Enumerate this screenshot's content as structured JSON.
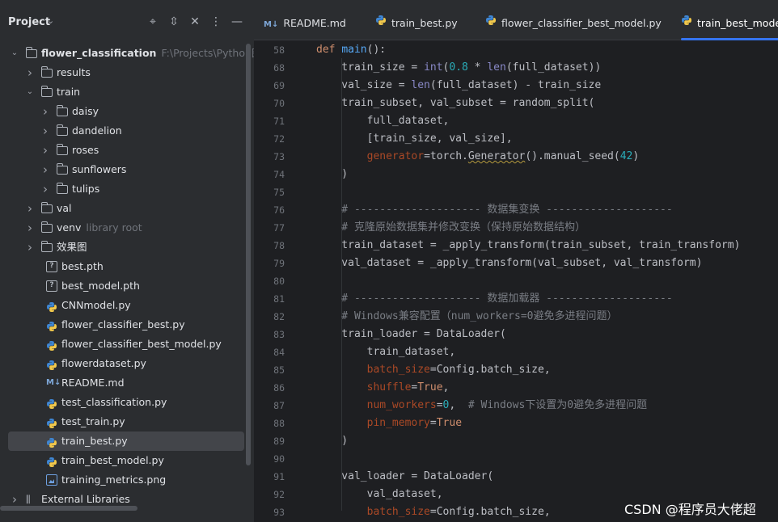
{
  "project_panel": {
    "title": "Project",
    "header_icons": [
      "locate-icon",
      "expand-collapse-icon",
      "collapse-all-icon",
      "more-options-icon",
      "minimize-icon"
    ],
    "tree": [
      {
        "depth": 0,
        "type": "folder",
        "expanded": true,
        "name": "flower_classification",
        "hint": "F:\\Projects\\Python图像识",
        "bold": true
      },
      {
        "depth": 1,
        "type": "folder",
        "expanded": false,
        "name": "results"
      },
      {
        "depth": 1,
        "type": "folder",
        "expanded": true,
        "name": "train"
      },
      {
        "depth": 2,
        "type": "folder",
        "expanded": false,
        "name": "daisy"
      },
      {
        "depth": 2,
        "type": "folder",
        "expanded": false,
        "name": "dandelion"
      },
      {
        "depth": 2,
        "type": "folder",
        "expanded": false,
        "name": "roses"
      },
      {
        "depth": 2,
        "type": "folder",
        "expanded": false,
        "name": "sunflowers"
      },
      {
        "depth": 2,
        "type": "folder",
        "expanded": false,
        "name": "tulips"
      },
      {
        "depth": 1,
        "type": "folder",
        "expanded": false,
        "name": "val"
      },
      {
        "depth": 1,
        "type": "folder",
        "expanded": false,
        "name": "venv",
        "hint": "library root"
      },
      {
        "depth": 1,
        "type": "folder",
        "expanded": false,
        "name": "效果图"
      },
      {
        "depth": 1,
        "type": "unknown",
        "name": "best.pth"
      },
      {
        "depth": 1,
        "type": "unknown",
        "name": "best_model.pth"
      },
      {
        "depth": 1,
        "type": "python",
        "name": "CNNmodel.py"
      },
      {
        "depth": 1,
        "type": "python",
        "name": "flower_classifier_best.py"
      },
      {
        "depth": 1,
        "type": "python",
        "name": "flower_classifier_best_model.py"
      },
      {
        "depth": 1,
        "type": "python",
        "name": "flowerdataset.py"
      },
      {
        "depth": 1,
        "type": "markdown",
        "name": "README.md"
      },
      {
        "depth": 1,
        "type": "python",
        "name": "test_classification.py"
      },
      {
        "depth": 1,
        "type": "python",
        "name": "test_train.py"
      },
      {
        "depth": 1,
        "type": "python",
        "name": "train_best.py",
        "selected": true
      },
      {
        "depth": 1,
        "type": "python",
        "name": "train_best_model.py"
      },
      {
        "depth": 1,
        "type": "image",
        "name": "training_metrics.png"
      },
      {
        "depth": 0,
        "type": "library",
        "expanded": false,
        "name": "External Libraries"
      }
    ]
  },
  "tabs": [
    {
      "label": "README.md",
      "type": "markdown",
      "active": false
    },
    {
      "label": "train_best.py",
      "type": "python",
      "active": false
    },
    {
      "label": "flower_classifier_best_model.py",
      "type": "python",
      "active": false
    },
    {
      "label": "train_best_model",
      "type": "python",
      "active": true
    }
  ],
  "editor": {
    "line_numbers": [
      "58",
      "68",
      "69",
      "70",
      "71",
      "72",
      "73",
      "74",
      "75",
      "76",
      "77",
      "78",
      "79",
      "80",
      "81",
      "82",
      "83",
      "84",
      "85",
      "86",
      "87",
      "88",
      "89",
      "90",
      "91",
      "92",
      "93"
    ],
    "lines": [
      [
        [
          "kw",
          "def "
        ],
        [
          "fn",
          "main"
        ],
        [
          "",
          "():"
        ]
      ],
      [
        [
          "",
          "    train_size = "
        ],
        [
          "bi",
          "int"
        ],
        [
          "",
          "("
        ],
        [
          "num",
          "0.8"
        ],
        [
          "",
          " * "
        ],
        [
          "bi",
          "len"
        ],
        [
          "",
          "(full_dataset))"
        ]
      ],
      [
        [
          "",
          "    val_size = "
        ],
        [
          "bi",
          "len"
        ],
        [
          "",
          "(full_dataset) - train_size"
        ]
      ],
      [
        [
          "",
          "    train_subset, val_subset = random_split("
        ]
      ],
      [
        [
          "",
          "        full_dataset,"
        ]
      ],
      [
        [
          "",
          "        [train_size, val_size],"
        ]
      ],
      [
        [
          "param",
          "        generator"
        ],
        [
          "",
          "=torch."
        ],
        [
          "wavy",
          "Generator"
        ],
        [
          "",
          "().manual_seed("
        ],
        [
          "num",
          "42"
        ],
        [
          "",
          ")"
        ]
      ],
      [
        [
          "",
          "    )"
        ]
      ],
      [
        [
          "",
          ""
        ]
      ],
      [
        [
          "cmt",
          "    # -------------------- 数据集变换 --------------------"
        ]
      ],
      [
        [
          "cmt",
          "    # 克隆原始数据集并修改变换（保持原始数据结构）"
        ]
      ],
      [
        [
          "",
          "    train_dataset = _apply_transform(train_subset, train_transform)"
        ]
      ],
      [
        [
          "",
          "    val_dataset = _apply_transform(val_subset, val_transform)"
        ]
      ],
      [
        [
          "",
          ""
        ]
      ],
      [
        [
          "cmt",
          "    # -------------------- 数据加载器 --------------------"
        ]
      ],
      [
        [
          "cmt",
          "    # Windows兼容配置（num_workers=0避免多进程问题）"
        ]
      ],
      [
        [
          "",
          "    train_loader = DataLoader("
        ]
      ],
      [
        [
          "",
          "        train_dataset,"
        ]
      ],
      [
        [
          "param",
          "        batch_size"
        ],
        [
          "",
          "=Config.batch_size,"
        ]
      ],
      [
        [
          "param",
          "        shuffle"
        ],
        [
          "",
          "="
        ],
        [
          "kw",
          "True"
        ],
        [
          "",
          ","
        ]
      ],
      [
        [
          "param",
          "        num_workers"
        ],
        [
          "",
          "="
        ],
        [
          "num",
          "0"
        ],
        [
          "",
          ",  "
        ],
        [
          "cmt",
          "# Windows下设置为0避免多进程问题"
        ]
      ],
      [
        [
          "param",
          "        pin_memory"
        ],
        [
          "",
          "="
        ],
        [
          "kw",
          "True"
        ]
      ],
      [
        [
          "",
          "    )"
        ]
      ],
      [
        [
          "",
          ""
        ]
      ],
      [
        [
          "",
          "    val_loader = DataLoader("
        ]
      ],
      [
        [
          "",
          "        val_dataset,"
        ]
      ],
      [
        [
          "param",
          "        batch_size"
        ],
        [
          "",
          "=Config.batch_size,"
        ]
      ]
    ]
  },
  "watermark": "CSDN @程序员大佬超"
}
